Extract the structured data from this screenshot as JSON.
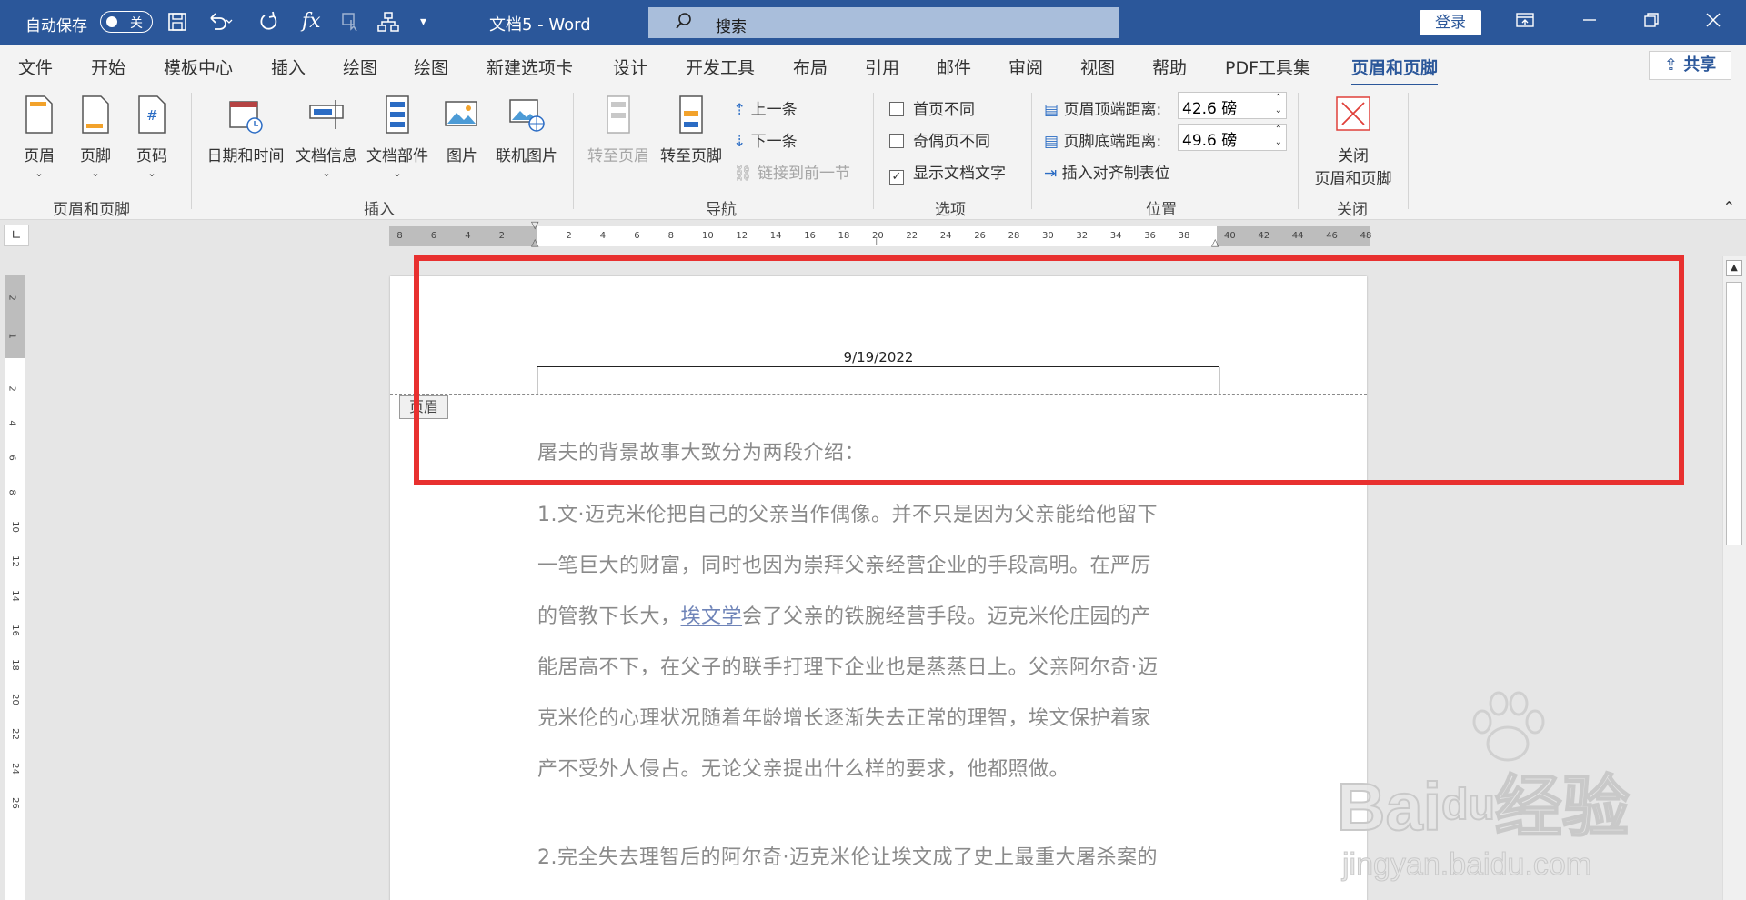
{
  "titlebar": {
    "autosave_label": "自动保存",
    "autosave_state": "关",
    "doc_title": "文档5 - Word",
    "search_placeholder": "搜索",
    "login_label": "登录"
  },
  "menu": {
    "tabs": [
      "文件",
      "开始",
      "模板中心",
      "插入",
      "绘图",
      "绘图",
      "新建选项卡",
      "设计",
      "开发工具",
      "布局",
      "引用",
      "邮件",
      "审阅",
      "视图",
      "帮助",
      "PDF工具集",
      "页眉和页脚"
    ],
    "active_tab": "页眉和页脚",
    "share_label": "共享"
  },
  "ribbon": {
    "groups": {
      "header_footer": {
        "label": "页眉和页脚",
        "buttons": [
          "页眉",
          "页脚",
          "页码"
        ]
      },
      "insert": {
        "label": "插入",
        "buttons": [
          "日期和时间",
          "文档信息",
          "文档部件",
          "图片",
          "联机图片"
        ]
      },
      "navigation": {
        "label": "导航",
        "goto_header": "转至页眉",
        "goto_footer": "转至页脚",
        "previous": "上一条",
        "next": "下一条",
        "link_previous": "链接到前一节"
      },
      "options": {
        "label": "选项",
        "different_first": "首页不同",
        "different_odd_even": "奇偶页不同",
        "show_doc_text": "显示文档文字",
        "different_first_checked": false,
        "different_odd_even_checked": false,
        "show_doc_text_checked": true
      },
      "position": {
        "label": "位置",
        "header_top_label": "页眉顶端距离:",
        "header_top_value": "42.6 磅",
        "footer_bottom_label": "页脚底端距离:",
        "footer_bottom_value": "49.6 磅",
        "insert_align_tab": "插入对齐制表位"
      },
      "close": {
        "label": "关闭",
        "button_line1": "关闭",
        "button_line2": "页眉和页脚"
      }
    }
  },
  "ruler": {
    "h_left_numbers": [
      "8",
      "6",
      "4",
      "2"
    ],
    "h_numbers": [
      "2",
      "4",
      "6",
      "8",
      "10",
      "12",
      "14",
      "16",
      "18",
      "20",
      "22",
      "24",
      "26",
      "28",
      "30",
      "32",
      "34",
      "36",
      "38"
    ],
    "h_right_numbers": [
      "40",
      "42",
      "44",
      "46",
      "48"
    ],
    "v_numbers": [
      "2",
      "1",
      "2",
      "4",
      "6",
      "8",
      "10",
      "12",
      "14",
      "16",
      "18",
      "20",
      "22",
      "24",
      "26"
    ]
  },
  "document": {
    "header_date": "9/19/2022",
    "header_tag": "页眉",
    "intro": "屠夫的背景故事大致分为两段介绍：",
    "p1_lines": [
      "1.文·迈克米伦把自己的父亲当作偶像。并不只是因为父亲能给他留下",
      "一笔巨大的财富，同时也因为崇拜父亲经营企业的手段高明。在严厉"
    ],
    "p1_line3_before": "的管教下长大，",
    "p1_line3_link": "埃文学",
    "p1_line3_after": "会了父亲的铁腕经营手段。迈克米伦庄园的产",
    "p1_lines_rest": [
      "能居高不下，在父子的联手打理下企业也是蒸蒸日上。父亲阿尔奇·迈",
      "克米伦的心理状况随着年龄增长逐渐失去正常的理智，埃文保护着家",
      "产不受外人侵占。无论父亲提出什么样的要求，他都照做。"
    ],
    "p2_line1": "2.完全失去理智后的阿尔奇·迈克米伦让埃文成了史上最重大屠杀案的"
  },
  "watermark": {
    "brand": "Bai",
    "brand_cn": "经验",
    "url": "jingyan.baidu.com"
  },
  "colors": {
    "titlebar": "#2b579a",
    "annotation": "#e8302f",
    "body_text": "#8a8a8a"
  }
}
